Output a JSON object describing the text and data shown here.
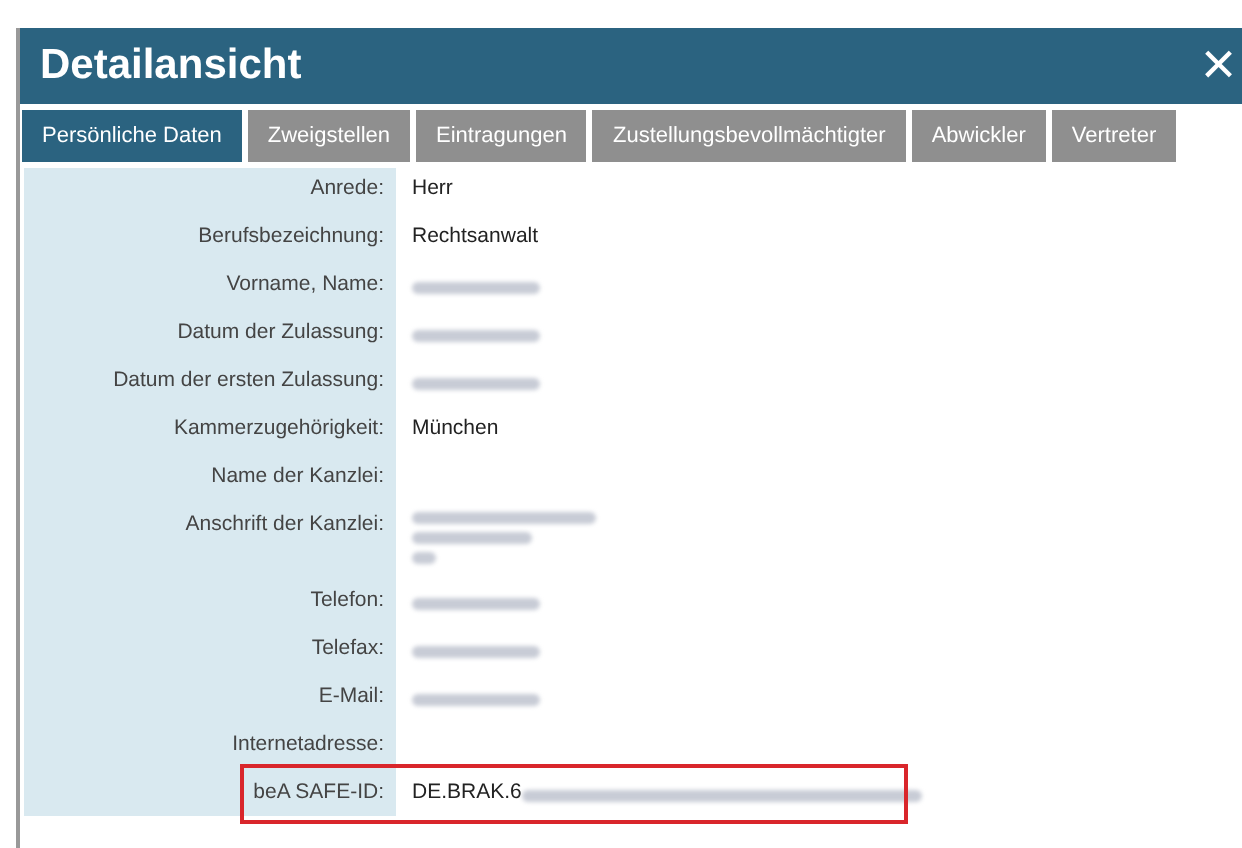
{
  "dialog": {
    "title": "Detailansicht",
    "close": "×"
  },
  "tabs": [
    {
      "label": "Persönliche Daten",
      "selected": true
    },
    {
      "label": "Zweigstellen",
      "selected": false
    },
    {
      "label": "Eintragungen",
      "selected": false
    },
    {
      "label": "Zustellungsbevollmächtigter",
      "selected": false
    },
    {
      "label": "Abwickler",
      "selected": false
    },
    {
      "label": "Vertreter",
      "selected": false
    }
  ],
  "fields": [
    {
      "label": "Anrede:",
      "value": "Herr"
    },
    {
      "label": "Berufsbezeichnung:",
      "value": "Rechtsanwalt"
    },
    {
      "label": "Vorname, Name:",
      "blurred": [
        true
      ]
    },
    {
      "label": "Datum der Zulassung:",
      "blurred": [
        true
      ]
    },
    {
      "label": "Datum der ersten Zulassung:",
      "blurred": [
        true
      ]
    },
    {
      "label": "Kammerzugehörigkeit:",
      "value": "München"
    },
    {
      "label": "Name der Kanzlei:"
    },
    {
      "label": "Anschrift der Kanzlei:",
      "blurred": [
        true,
        true,
        true
      ]
    },
    {
      "label": "Telefon:",
      "blurred": [
        true
      ]
    },
    {
      "label": "Telefax:",
      "blurred": [
        true
      ]
    },
    {
      "label": "E-Mail:",
      "blurred": [
        true
      ]
    },
    {
      "label": "Internetadresse:"
    },
    {
      "label": "beA SAFE-ID:",
      "value": "DE.BRAK.6",
      "blurred": [
        true
      ],
      "highlighted": true
    }
  ]
}
